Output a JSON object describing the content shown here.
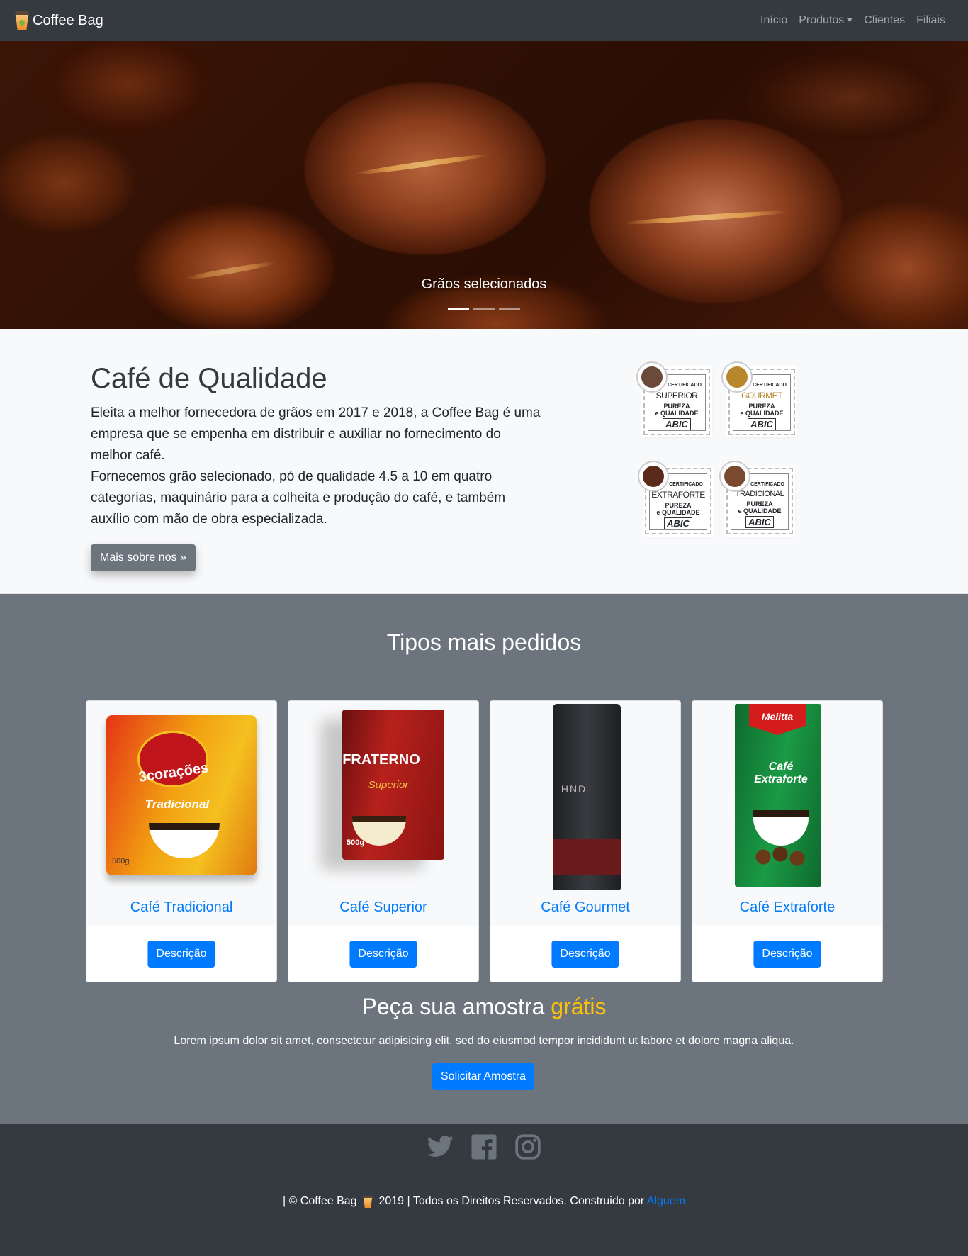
{
  "navbar": {
    "brand": "Coffee Bag",
    "links": [
      "Início",
      "Produtos",
      "Clientes",
      "Filiais"
    ]
  },
  "carousel": {
    "caption": "Grãos selecionados",
    "slides": 3,
    "active_slide": 1
  },
  "about": {
    "title": "Café de Qualidade",
    "paragraph1": "Eleita a melhor fornecedora de grãos em 2017 e 2018, a Coffee Bag é uma empresa que se empenha em distribuir e auxiliar no fornecimento do melhor café.",
    "paragraph2": "Fornecemos grão selecionado, pó de qualidade 4.5 a 10 em quatro categorias, maquinário para a colheita e produção do café, e também auxílio com mão de obra especializada.",
    "button": "Mais sobre nos »",
    "seals": [
      {
        "category": "SUPERIOR",
        "cert": "CERTIFICADO",
        "line1": "PUREZA",
        "line2": "e QUALIDADE",
        "brand": "ABIC",
        "color": "#6b4a3a"
      },
      {
        "category": "GOURMET",
        "cert": "CERTIFICADO",
        "line1": "PUREZA",
        "line2": "e QUALIDADE",
        "brand": "ABIC",
        "color": "#b8862b"
      },
      {
        "category": "EXTRAFORTE",
        "cert": "CERTIFICADO",
        "line1": "PUREZA",
        "line2": "e QUALIDADE",
        "brand": "ABIC",
        "color": "#5a2a1a"
      },
      {
        "category": "TRADICIONAL",
        "cert": "CERTIFICADO",
        "line1": "PUREZA",
        "line2": "e QUALIDADE",
        "brand": "ABIC",
        "color": "#7a4a30"
      }
    ]
  },
  "products": {
    "heading": "Tipos mais pedidos",
    "items": [
      {
        "name": "Café Tradicional",
        "button": "Descrição",
        "pack_brand": "3corações",
        "pack_type": "Tradicional",
        "pack_weight": "500g"
      },
      {
        "name": "Café Superior",
        "button": "Descrição",
        "pack_brand": "FRATERNO",
        "pack_type": "Superior",
        "pack_weight": "500g"
      },
      {
        "name": "Café Gourmet",
        "button": "Descrição",
        "pack_brand": "HND"
      },
      {
        "name": "Café Extraforte",
        "button": "Descrição",
        "pack_brand": "Melitta",
        "pack_type": "Café Extraforte"
      }
    ]
  },
  "sample": {
    "title_prefix": "Peça sua amostra",
    "title_highlight": "grátis",
    "text": "Lorem ipsum dolor sit amet, consectetur adipisicing elit, sed do eiusmod tempor incididunt ut labore et dolore magna aliqua.",
    "button": "Solicitar Amostra"
  },
  "footer": {
    "social": [
      "twitter-icon",
      "facebook-icon",
      "instagram-icon"
    ],
    "copy_prefix": "| © Coffee Bag",
    "copy_suffix": "2019 | Todos os Direitos Reservados. Construido por",
    "author": "Alguem"
  },
  "colors": {
    "navbar": "#343a40",
    "products_bg": "#6c757d",
    "primary": "#007bff",
    "highlight": "#ffc107"
  }
}
